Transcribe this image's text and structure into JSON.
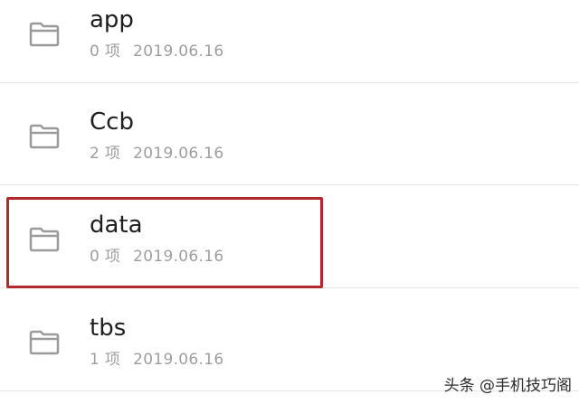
{
  "folders": [
    {
      "name": "app",
      "count": "0 项",
      "date": "2019.06.16",
      "icon": "folder-icon"
    },
    {
      "name": "Ccb",
      "count": "2 项",
      "date": "2019.06.16",
      "icon": "folder-icon"
    },
    {
      "name": "data",
      "count": "0 项",
      "date": "2019.06.16",
      "icon": "folder-icon"
    },
    {
      "name": "tbs",
      "count": "1 项",
      "date": "2019.06.16",
      "icon": "folder-icon"
    }
  ],
  "highlight": {
    "folder": "data",
    "color": "#b3272d"
  },
  "watermark": {
    "text": "头条 @手机技巧阁"
  },
  "colors": {
    "icon": "#9a9a9a",
    "name": "#1e1e1e",
    "meta": "#9e9e9e",
    "divider": "#e6e6e6"
  }
}
